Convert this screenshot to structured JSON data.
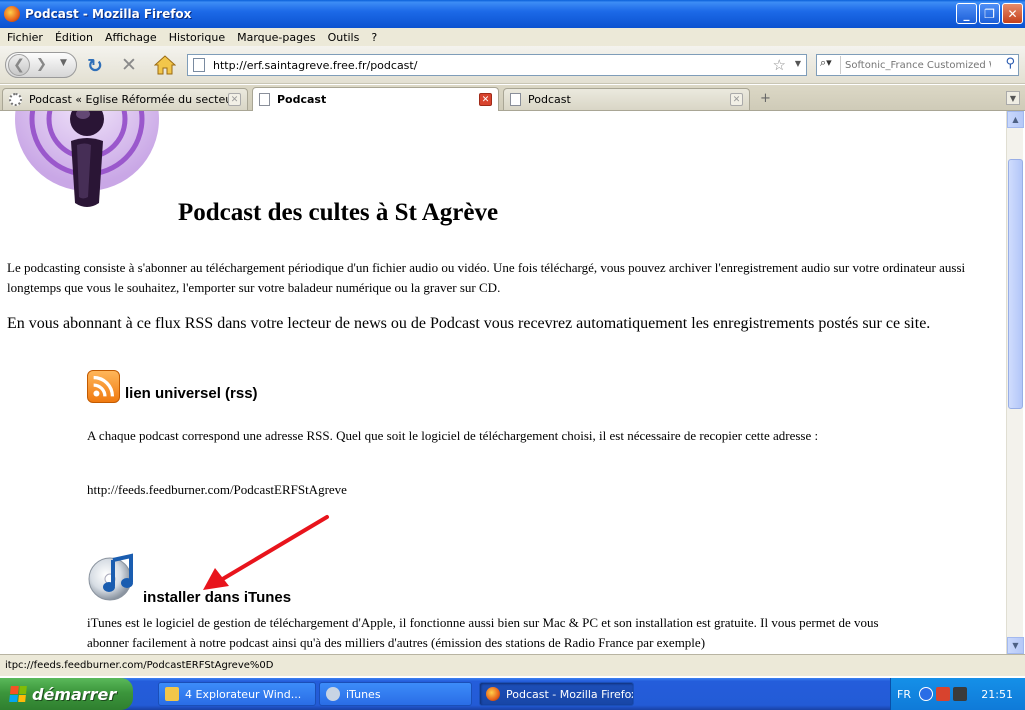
{
  "window": {
    "title": "Podcast - Mozilla Firefox"
  },
  "menubar": {
    "items": [
      "Fichier",
      "Édition",
      "Affichage",
      "Historique",
      "Marque-pages",
      "Outils",
      "?"
    ]
  },
  "navbar": {
    "url": "http://erf.saintagreve.free.fr/podcast/",
    "search_placeholder": "Softonic_France Customized W"
  },
  "tabs": [
    {
      "label": "Podcast « Eglise Réformée du secteur ...",
      "active": false
    },
    {
      "label": "Podcast",
      "active": true
    },
    {
      "label": "Podcast",
      "active": false
    }
  ],
  "page": {
    "title": "Podcast des cultes à St Agrève",
    "intro": "Le podcasting consiste à s'abonner au téléchargement périodique d'un fichier audio ou vidéo. Une fois téléchargé, vous pouvez archiver l'enregistrement audio sur votre ordinateur aussi longtemps que vous le souhaitez, l'emporter sur votre baladeur numérique ou la graver sur CD.",
    "rss_lead": "En vous abonnant à ce flux RSS dans votre lecteur de news ou de Podcast vous recevrez automatiquement les enregistrements postés sur ce site.",
    "rss_heading": "lien universel (rss)",
    "rss_text": "A chaque podcast correspond une adresse RSS. Quel que soit le logiciel de téléchargement choisi, il est nécessaire de recopier cette adresse :",
    "feed_url": "http://feeds.feedburner.com/PodcastERFStAgreve",
    "itunes_heading": "installer dans iTunes",
    "itunes_text": "iTunes est le logiciel de gestion de téléchargement d'Apple, il fonctionne aussi bien sur Mac & PC et son installation est gratuite. Il vous permet de vous abonner facilement à notre podcast ainsi qu'à des milliers d'autres (émission des stations de Radio France par exemple)"
  },
  "statusbar": {
    "text": "itpc://feeds.feedburner.com/PodcastERFStAgreve%0D"
  },
  "taskbar": {
    "start_label": "démarrer",
    "tasks": [
      {
        "label": "4 Explorateur Wind...",
        "active": false
      },
      {
        "label": "iTunes",
        "active": false
      },
      {
        "label": "Podcast - Mozilla Firefox",
        "active": true
      }
    ],
    "lang": "FR",
    "clock": "21:51"
  },
  "colors": {
    "titlebar": "#0b52d0",
    "annotation_arrow": "#e8141c",
    "rss_orange": "#f07a10"
  }
}
